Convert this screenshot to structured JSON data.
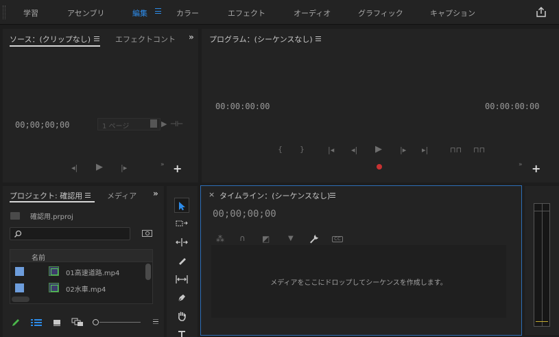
{
  "workspaces": {
    "items": [
      {
        "label": "学習"
      },
      {
        "label": "アセンブリ"
      },
      {
        "label": "編集"
      },
      {
        "label": "カラー"
      },
      {
        "label": "エフェクト"
      },
      {
        "label": "オーディオ"
      },
      {
        "label": "グラフィック"
      },
      {
        "label": "キャプション"
      }
    ],
    "active": "編集"
  },
  "source_panel": {
    "tab_source": "ソース：(クリップなし)",
    "tab_effects": "エフェクトコント",
    "timecode": "00;00;00;00",
    "page_select": "1 ページ"
  },
  "program_panel": {
    "title": "プログラム：(シーケンスなし)",
    "timecode_left": "00:00:00:00",
    "timecode_right": "00:00:00:00"
  },
  "project_panel": {
    "tab_project": "プロジェクト: 確認用",
    "tab_media": "メディア",
    "project_file": "確認用.prproj",
    "search": {
      "value": "",
      "placeholder": ""
    },
    "column_name": "名前",
    "items": [
      {
        "name": "01高速道路.mp4",
        "color": "#6d9ddc"
      },
      {
        "name": "02水車.mp4",
        "color": "#6d9ddc"
      }
    ]
  },
  "timeline_panel": {
    "title": "タイムライン：(シーケンスなし)",
    "timecode": "00;00;00;00",
    "drop_message": "メディアをここにドロップしてシーケンスを作成します。"
  },
  "colors": {
    "accent": "#2d8ceb",
    "panel_bg": "#232323",
    "record": "#c83232"
  },
  "icons": {
    "share": "share-icon",
    "selection_tool": "arrow-icon",
    "track_select": "track-select-icon",
    "ripple_edit": "ripple-edit-icon",
    "razor": "razor-icon",
    "slip": "slip-icon",
    "pen": "pen-icon",
    "hand": "hand-icon",
    "type": "type-icon"
  }
}
